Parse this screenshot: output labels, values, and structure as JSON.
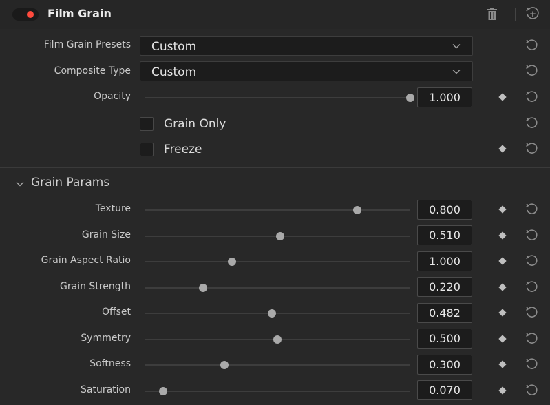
{
  "header": {
    "title": "Film Grain",
    "enabled": true,
    "toggle_color": "#ff4a3d",
    "delete_icon": "trash-icon",
    "add_icon": "add-circle-icon"
  },
  "presets": {
    "label": "Film Grain Presets",
    "value": "Custom"
  },
  "composite": {
    "label": "Composite Type",
    "value": "Custom"
  },
  "opacity": {
    "label": "Opacity",
    "value": "1.000",
    "fraction": 1.0
  },
  "grain_only": {
    "label": "Grain Only",
    "checked": false
  },
  "freeze": {
    "label": "Freeze",
    "checked": false
  },
  "grain_params": {
    "title": "Grain Params",
    "expanded": true,
    "params": [
      {
        "label": "Texture",
        "value": "0.800",
        "fraction": 0.8
      },
      {
        "label": "Grain Size",
        "value": "0.510",
        "fraction": 0.51
      },
      {
        "label": "Grain Aspect Ratio",
        "value": "1.000",
        "fraction": 0.33
      },
      {
        "label": "Grain Strength",
        "value": "0.220",
        "fraction": 0.22
      },
      {
        "label": "Offset",
        "value": "0.482",
        "fraction": 0.48
      },
      {
        "label": "Symmetry",
        "value": "0.500",
        "fraction": 0.5
      },
      {
        "label": "Softness",
        "value": "0.300",
        "fraction": 0.3
      },
      {
        "label": "Saturation",
        "value": "0.070",
        "fraction": 0.07
      }
    ]
  }
}
